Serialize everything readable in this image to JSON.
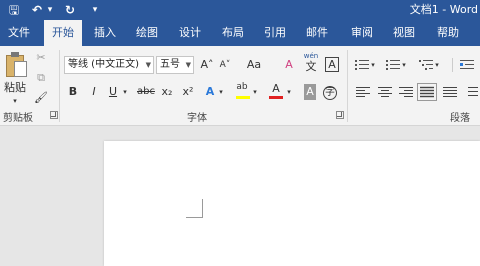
{
  "titlebar": {
    "doc_title": "文档1 - Word",
    "quick_access": {
      "save": "🖫",
      "undo": "↶",
      "undo_dropdown": "▾",
      "redo": "↻",
      "customize": "▾"
    }
  },
  "tabs": [
    {
      "label": "文件"
    },
    {
      "label": "开始"
    },
    {
      "label": "插入"
    },
    {
      "label": "绘图"
    },
    {
      "label": "设计"
    },
    {
      "label": "布局"
    },
    {
      "label": "引用"
    },
    {
      "label": "邮件"
    },
    {
      "label": "审阅"
    },
    {
      "label": "视图"
    },
    {
      "label": "帮助"
    }
  ],
  "active_tab": "开始",
  "clipboard": {
    "paste_label": "粘贴",
    "paste_dropdown": "▾",
    "group_label": "剪贴板",
    "cut": "✂",
    "copy": "⧉",
    "format_painter": "🖌"
  },
  "font": {
    "group_label": "字体",
    "font_name": "等线 (中文正文)",
    "font_size": "五号",
    "grow": "A˄",
    "shrink": "A˅",
    "change_case": "Aa",
    "clear_format": "A",
    "phonetic": "wén",
    "phonetic_char": "文",
    "char_border": "A",
    "bold": "B",
    "italic": "I",
    "underline": "U",
    "strike": "abc",
    "subscript": "x₂",
    "superscript": "x²",
    "text_effects": "A",
    "highlight": "ab",
    "font_color": "A",
    "char_shading": "A",
    "enclose_char": "字"
  },
  "paragraph": {
    "group_label": "段落"
  },
  "colors": {
    "accent": "#2b579a",
    "highlight_yellow": "#ffff00",
    "font_red": "#e02020"
  }
}
